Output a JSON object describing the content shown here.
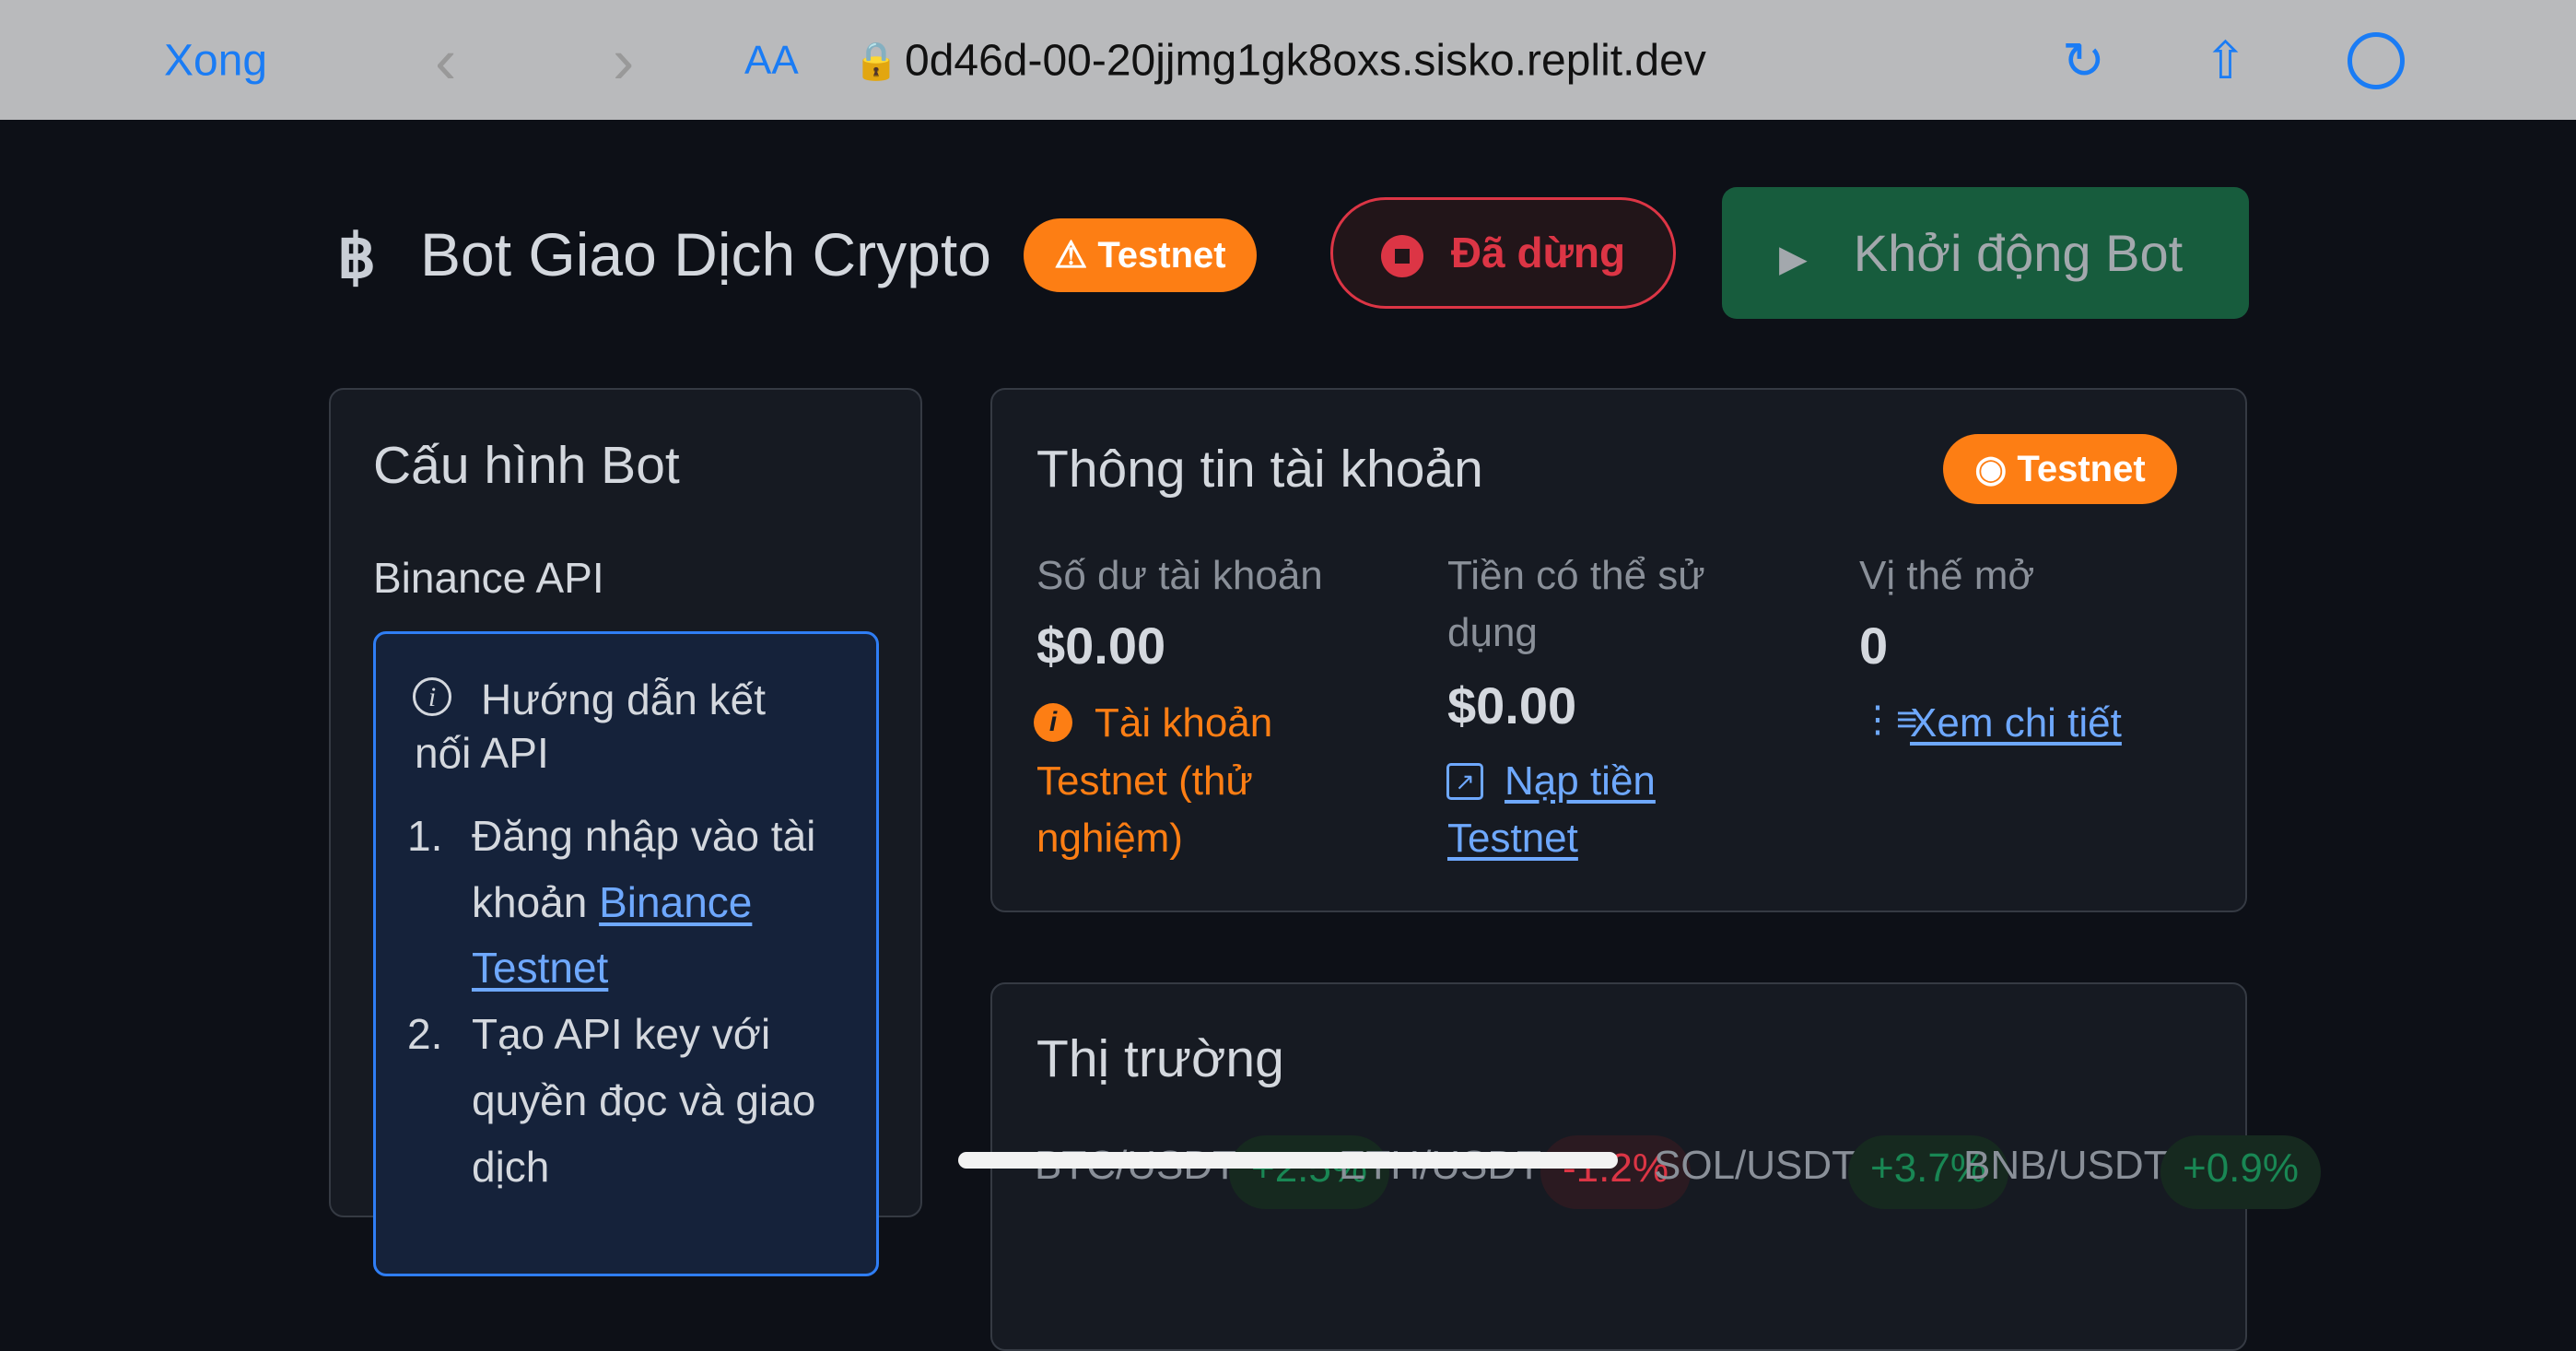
{
  "browser": {
    "done": "Xong",
    "text_size": "AA",
    "url": "0d46d-00-20jjmg1gk8oxs.sisko.replit.dev"
  },
  "header": {
    "title": "Bot Giao Dịch Crypto",
    "badge": "Testnet",
    "status": "Đã dừng",
    "start": "Khởi động Bot"
  },
  "config": {
    "title": "Cấu hình Bot",
    "section": "Binance API",
    "guide_title_1": "Hướng dẫn kết",
    "guide_title_2": "nối API",
    "steps": [
      {
        "n": "1.",
        "l1": "Đăng nhập vào tài",
        "l2a": "khoản ",
        "link1": "Binance",
        "link2": "Testnet"
      },
      {
        "n": "2.",
        "l1": "Tạo API key với",
        "l2": "quyền đọc và giao",
        "l3": "dịch"
      }
    ]
  },
  "account": {
    "title": "Thông tin tài khoản",
    "badge": "Testnet",
    "balance_label": "Số dư tài khoản",
    "balance": "$0.00",
    "note1": "Tài khoản",
    "note2": "Testnet (thử",
    "note3": "nghiệm)",
    "available_label1": "Tiền có thể sử",
    "available_label2": "dụng",
    "available": "$0.00",
    "deposit1": "Nạp tiền",
    "deposit2": "Testnet",
    "positions_label": "Vị thế mở",
    "positions": "0",
    "details": "Xem chi tiết"
  },
  "market": {
    "title": "Thị trường",
    "items": [
      {
        "pair": "BTC/USDT",
        "change": "+2.5%"
      },
      {
        "pair": "ETH/USDT",
        "change": "-1.2%"
      },
      {
        "pair": "SOL/USDT",
        "change": "+3.7%"
      },
      {
        "pair": "BNB/USDT",
        "change": "+0.9%"
      }
    ]
  },
  "colors": {
    "accent": "#fd7e14",
    "danger": "#dc3545",
    "success": "#198754",
    "link": "#6ea8fe"
  }
}
